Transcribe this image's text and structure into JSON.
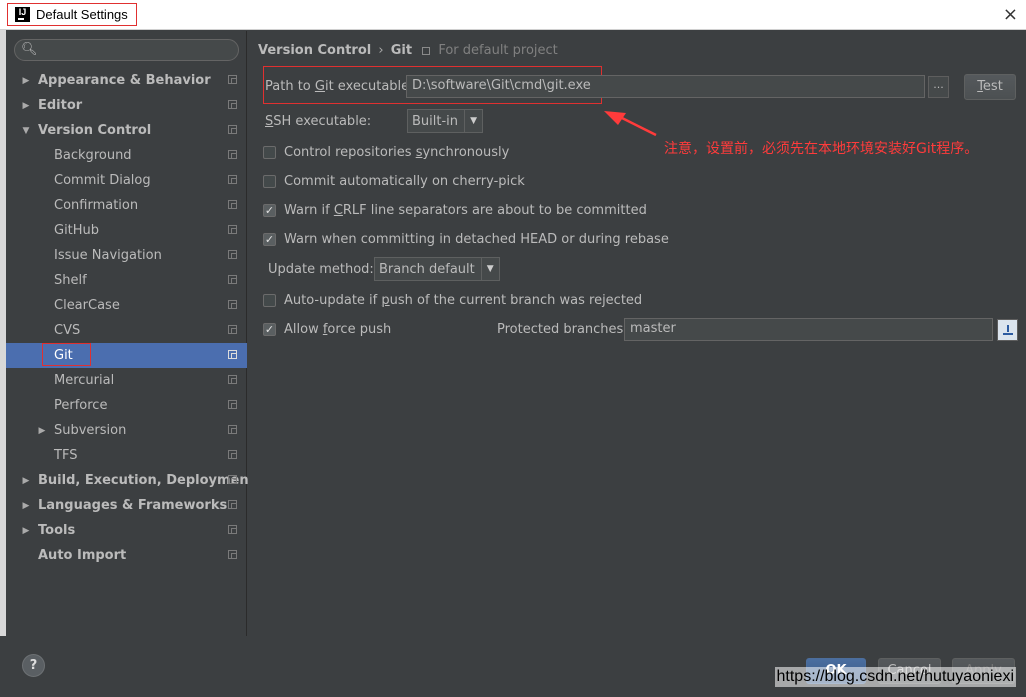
{
  "window": {
    "title": "Default Settings",
    "close": "×"
  },
  "search": {
    "placeholder": ""
  },
  "sidebar": {
    "items": [
      {
        "label": "Appearance & Behavior",
        "level": 0,
        "arrow": "right"
      },
      {
        "label": "Editor",
        "level": 0,
        "arrow": "right"
      },
      {
        "label": "Version Control",
        "level": 0,
        "arrow": "down"
      },
      {
        "label": "Background",
        "level": 1
      },
      {
        "label": "Commit Dialog",
        "level": 1
      },
      {
        "label": "Confirmation",
        "level": 1
      },
      {
        "label": "GitHub",
        "level": 1
      },
      {
        "label": "Issue Navigation",
        "level": 1
      },
      {
        "label": "Shelf",
        "level": 1
      },
      {
        "label": "ClearCase",
        "level": 1
      },
      {
        "label": "CVS",
        "level": 1
      },
      {
        "label": "Git",
        "level": 1,
        "selected": true
      },
      {
        "label": "Mercurial",
        "level": 1
      },
      {
        "label": "Perforce",
        "level": 1
      },
      {
        "label": "Subversion",
        "level": 1,
        "arrow": "right"
      },
      {
        "label": "TFS",
        "level": 1
      },
      {
        "label": "Build, Execution, Deployment",
        "level": 0,
        "arrow": "right"
      },
      {
        "label": "Languages & Frameworks",
        "level": 0,
        "arrow": "right"
      },
      {
        "label": "Tools",
        "level": 0,
        "arrow": "right"
      },
      {
        "label": "Auto Import",
        "level": 0
      }
    ]
  },
  "breadcrumb": {
    "part1": "Version Control",
    "sep": "›",
    "part2": "Git",
    "project": "For default project"
  },
  "git": {
    "path_label_pre": "Path to ",
    "path_label_u": "G",
    "path_label_post": "it executable:",
    "path_value": "D:\\software\\Git\\cmd\\git.exe",
    "dots": "...",
    "test_u": "T",
    "test_rest": "est",
    "ssh_label_u": "S",
    "ssh_label_rest": "SH executable:",
    "ssh_value": "Built-in",
    "options": [
      {
        "pre": "Control repositories ",
        "u": "s",
        "post": "ynchronously",
        "checked": false
      },
      {
        "pre": "Commit automatically on cherry-pick",
        "u": "",
        "post": "",
        "checked": false
      },
      {
        "pre": "Warn if ",
        "u": "C",
        "post": "RLF line separators are about to be committed",
        "checked": true
      },
      {
        "pre": "Warn when committing in detached HEAD or during rebase",
        "u": "",
        "post": "",
        "checked": true
      }
    ],
    "update_label": "Update method:",
    "update_value": "Branch default",
    "autoupdate": {
      "pre": "Auto-update if ",
      "u": "p",
      "post": "ush of the current branch was rejected",
      "checked": false
    },
    "force": {
      "pre": "Allow ",
      "u": "f",
      "post": "orce push",
      "checked": true
    },
    "protected_label": "Protected branches:",
    "protected_value": "master"
  },
  "annotation": {
    "text": "注意，设置前，必须先在本地环境安装好Git程序。",
    "color": "#ff3b3b"
  },
  "buttons": {
    "help": "?",
    "ok": "OK",
    "cancel": "Cancel",
    "apply": "Apply"
  },
  "watermark": "https://blog.csdn.net/hutuyaoniexi",
  "colors": {
    "selection": "#4b6eaf",
    "background": "#3c3f41",
    "highlight_box": "#e03030"
  }
}
